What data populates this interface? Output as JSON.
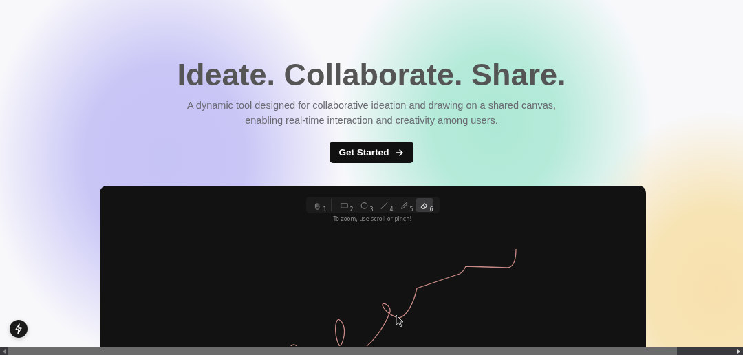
{
  "hero": {
    "title": "Ideate. Collaborate. Share.",
    "subtitle": "A dynamic tool designed for collaborative ideation and drawing on a shared canvas, enabling real-time interaction and creativity among users.",
    "button": "Get Started"
  },
  "demo": {
    "tools": [
      {
        "kind": "hand",
        "shortcut": "1",
        "selected": false
      },
      {
        "kind": "rectangle",
        "shortcut": "2",
        "selected": false
      },
      {
        "kind": "ellipse",
        "shortcut": "3",
        "selected": false
      },
      {
        "kind": "line",
        "shortcut": "4",
        "selected": false
      },
      {
        "kind": "pencil",
        "shortcut": "5",
        "selected": false
      },
      {
        "kind": "eraser",
        "shortcut": "6",
        "selected": true
      }
    ],
    "hint": "To zoom, use scroll or pinch!"
  }
}
